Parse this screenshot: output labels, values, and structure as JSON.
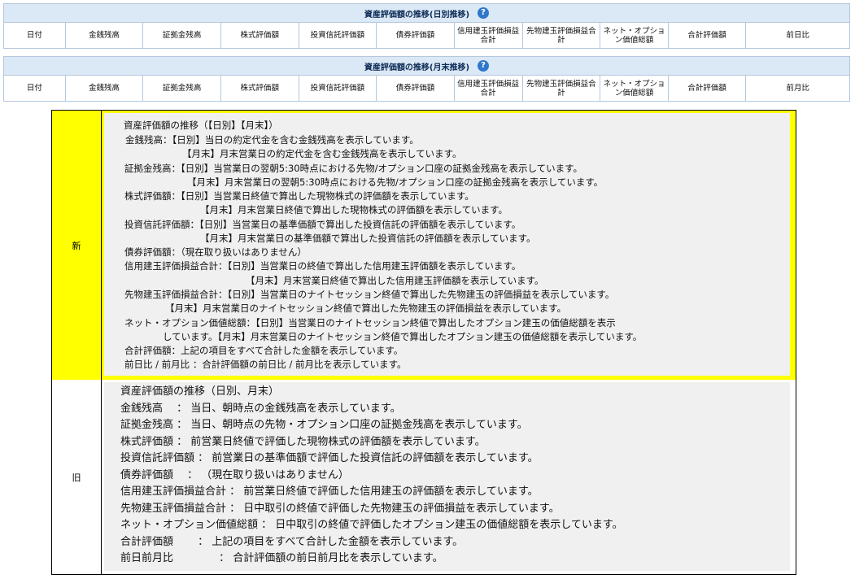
{
  "daily_table": {
    "title": "資産評価額の推移(日別推移)",
    "help_icon": "question-circle-icon",
    "columns": [
      "日付",
      "金銭残高",
      "証拠金残高",
      "株式評価額",
      "投資信託評価額",
      "債券評価額",
      "信用建玉評価損益合計",
      "先物建玉評価損益合計",
      "ネット・オプション価値総額",
      "合計評価額",
      "前日比"
    ]
  },
  "monthly_table": {
    "title": "資産評価額の推移(月末推移)",
    "help_icon": "question-circle-icon",
    "columns": [
      "日付",
      "金銭残高",
      "証拠金残高",
      "株式評価額",
      "投資信託評価額",
      "債券評価額",
      "信用建玉評価損益合計",
      "先物建玉評価損益合計",
      "ネット・オプション価値総額",
      "合計評価額",
      "前月比"
    ]
  },
  "notes": {
    "new_label": "新",
    "old_label": "旧",
    "new_lines": [
      "資産評価額の推移（【日別】【月末】）",
      "金銭残高：【日別】当日の約定代金を含む金銭残高を表示しています。",
      "【月末】月末営業日の約定代金を含む金銭残高を表示しています。",
      "証拠金残高：【日別】当営業日の翌朝5:30時点における先物/オプション口座の証拠金残高を表示しています。",
      "【月末】月末営業日の翌朝5:30時点における先物/オプション口座の証拠金残高を表示しています。",
      "株式評価額：【日別】当営業日終値で算出した現物株式の評価額を表示しています。",
      "【月末】月末営業日終値で算出した現物株式の評価額を表示しています。",
      "投資信託評価額：【日別】当営業日の基準価額で算出した投資信託の評価額を表示しています。",
      "【月末】月末営業日の基準価額で算出した投資信託の評価額を表示しています。",
      "債券評価額：（現在取り扱いはありません）",
      "信用建玉評価損益合計：【日別】当営業日の終値で算出した信用建玉評価額を表示しています。",
      "【月末】月末営業日終値で算出した信用建玉評価額を表示しています。",
      "先物建玉評価損益合計：【日別】当営業日のナイトセッション終値で算出した先物建玉の評価損益を表示しています。",
      "【月末】月末営業日のナイトセッション終値で算出した先物建玉の評価損益を表示しています。",
      "ネット・オプション価値総額：【日別】当営業日のナイトセッション終値で算出したオプション建玉の価値総額を表示",
      "しています。【月末】月末営業日のナイトセッション終値で算出したオプション建玉の価値総額を表示しています。",
      "合計評価額：上記の項目をすべて合計した金額を表示しています。",
      "前日比 / 前月比 ：合計評価額の前日比 / 前月比を表示しています。"
    ],
    "old_lines": [
      "資産評価額の推移（日別、月末）",
      "金銭残高　 ： 当日、朝時点の金銭残高を表示しています。",
      "証拠金残高 ： 当日、朝時点の先物・オプション口座の証拠金残高を表示しています。",
      "株式評価額 ： 前営業日終値で評価した現物株式の評価額を表示しています。",
      "投資信託評価額 ： 前営業日の基準価額で評価した投資信託の評価額を表示しています。",
      "債券評価額　 ： （現在取り扱いはありません）",
      "信用建玉評価損益合計 ： 前営業日終値で評価した信用建玉の評価額を表示しています。",
      "先物建玉評価損益合計 ： 日中取引の終値で評価した先物建玉の評価損益を表示しています。",
      "ネット・オプション価値総額 ： 日中取引の終値で評価したオプション建玉の価値総額を表示しています。",
      "合計評価額　　 ： 上記の項目をすべて合計した金額を表示しています。",
      "前日前月比　　　　 ： 合計評価額の前日前月比を表示しています。"
    ]
  }
}
